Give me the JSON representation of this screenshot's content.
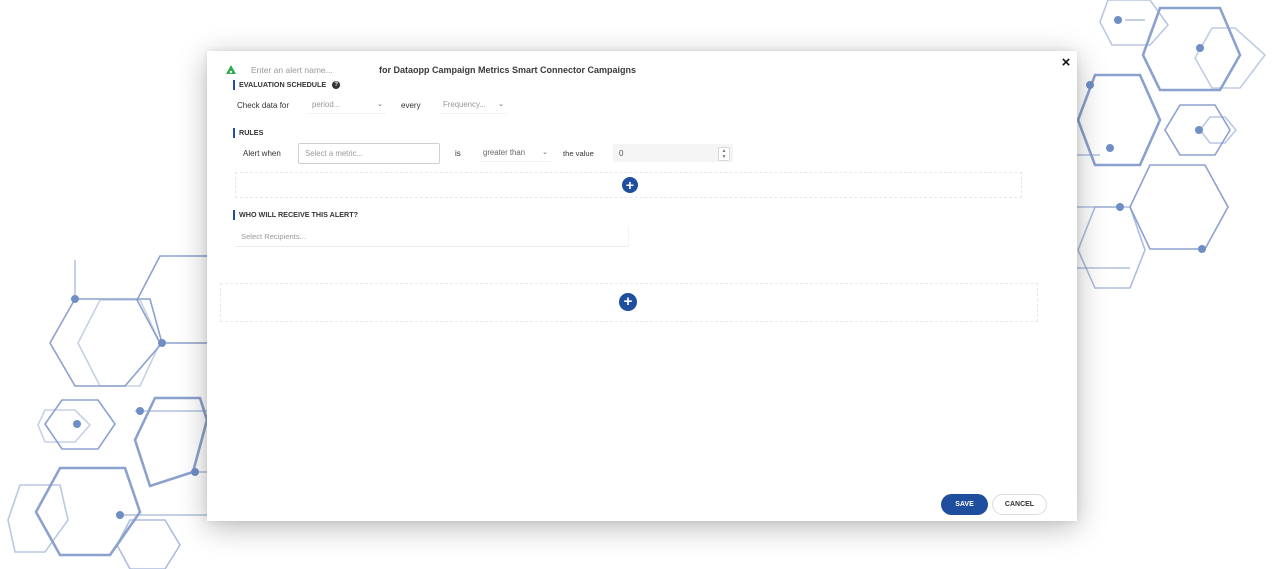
{
  "header": {
    "alert_name_placeholder": "Enter an alert name...",
    "title": "for Dataopp Campaign Metrics Smart Connector Campaigns",
    "close_icon": "×"
  },
  "evaluation_schedule": {
    "label": "EVALUATION SCHEDULE",
    "help_icon": "?",
    "check_label": "Check data for",
    "period_placeholder": "period...",
    "every_label": "every",
    "frequency_placeholder": "Frequency..."
  },
  "rules": {
    "label": "RULES",
    "alert_when_label": "Alert when",
    "metric_placeholder": "Select a metric...",
    "is_label": "is",
    "operator_value": "greater than",
    "value_label": "the value",
    "value": "0",
    "add_icon": "+"
  },
  "recipients": {
    "label": "WHO WILL RECEIVE THIS ALERT?",
    "placeholder": "Select Recipients...",
    "add_icon": "+"
  },
  "footer": {
    "save_label": "SAVE",
    "cancel_label": "CANCEL"
  },
  "colors": {
    "accent": "#1f4e9e",
    "decor_hex": "#6f8ec6",
    "alert_icon": "#2eab4f"
  },
  "icons": {
    "alert_icon": "bell-triangle-icon",
    "chevron": "chevron-down-icon",
    "close": "close-icon",
    "help": "help-icon",
    "add": "plus-circle-icon"
  }
}
